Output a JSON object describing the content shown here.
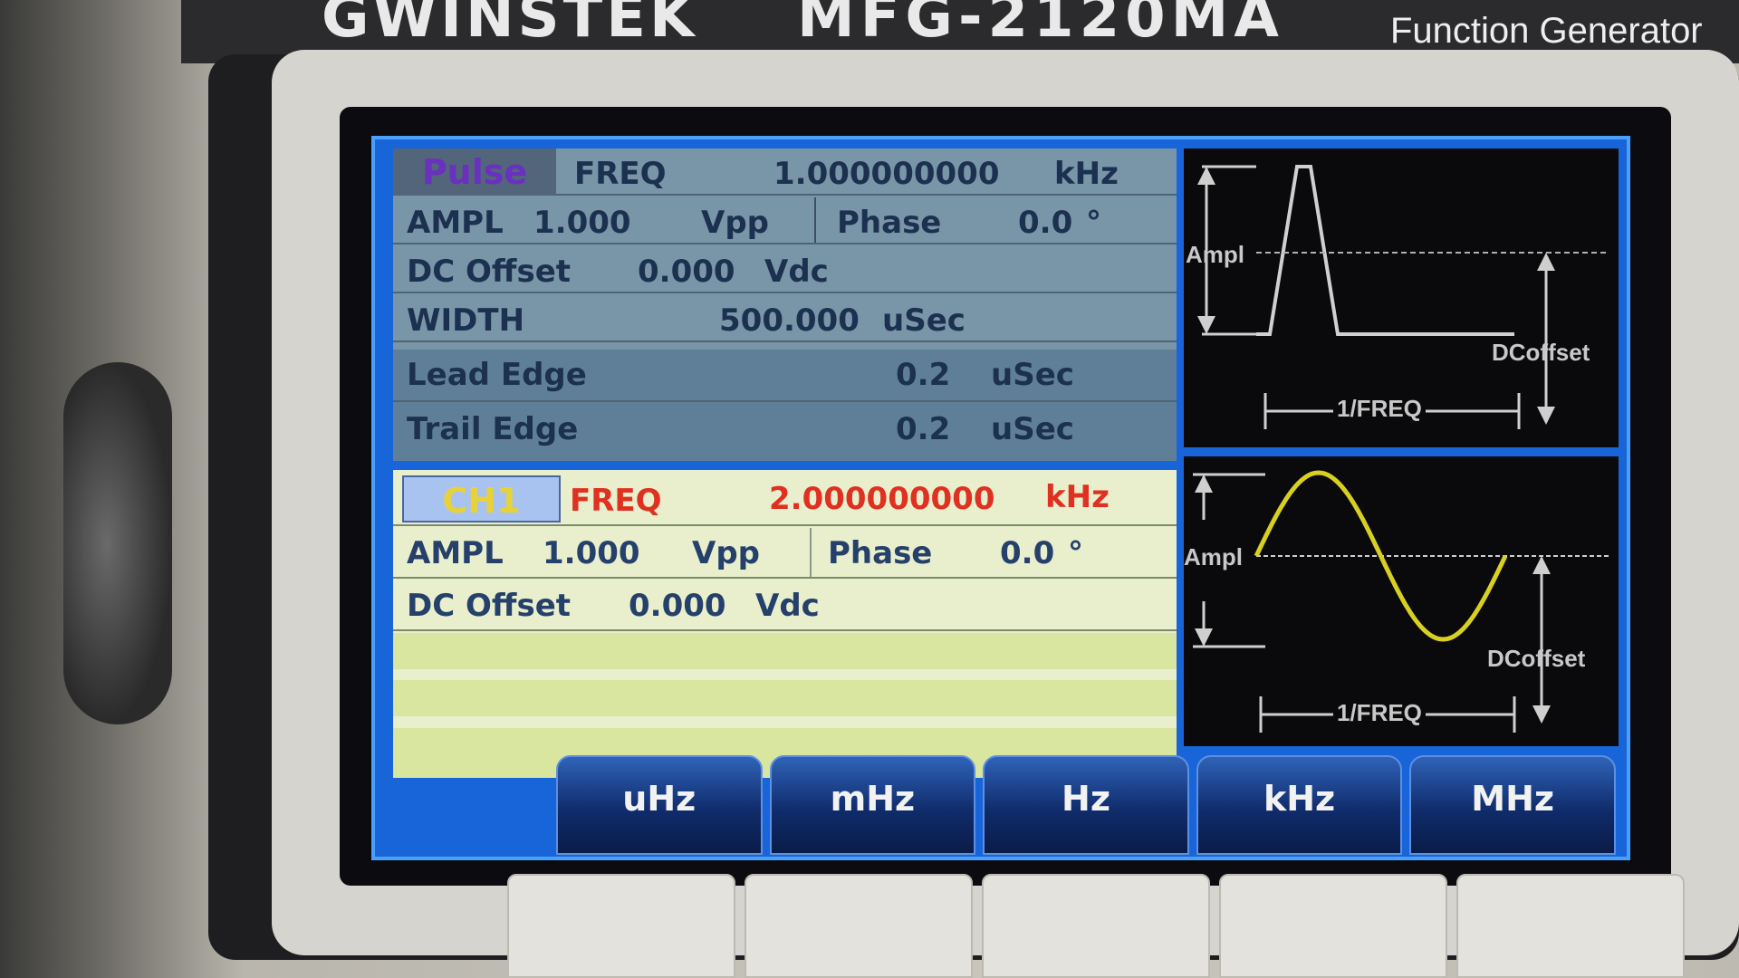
{
  "device": {
    "brand": "GWINSTEK",
    "model": "MFG-2120MA",
    "subtitle": "Function Generator"
  },
  "pulse_panel": {
    "tab_label": "Pulse",
    "freq_label": "FREQ",
    "freq_value": "1.000000000",
    "freq_unit": "kHz",
    "ampl_label": "AMPL",
    "ampl_value": "1.000",
    "ampl_unit": "Vpp",
    "phase_label": "Phase",
    "phase_value": "0.0",
    "phase_unit": "°",
    "dc_label": "DC Offset",
    "dc_value": "0.000",
    "dc_unit": "Vdc",
    "width_label": "WIDTH",
    "width_value": "500.000",
    "width_unit": "uSec",
    "lead_label": "Lead Edge",
    "lead_value": "0.2",
    "lead_unit": "uSec",
    "trail_label": "Trail Edge",
    "trail_value": "0.2",
    "trail_unit": "uSec"
  },
  "ch1_panel": {
    "tab_label": "CH1",
    "freq_label": "FREQ",
    "freq_value": "2.000000000",
    "freq_unit": "kHz",
    "ampl_label": "AMPL",
    "ampl_value": "1.000",
    "ampl_unit": "Vpp",
    "phase_label": "Phase",
    "phase_value": "0.0",
    "phase_unit": "°",
    "dc_label": "DC Offset",
    "dc_value": "0.000",
    "dc_unit": "Vdc"
  },
  "pulse_diagram": {
    "ampl_label": "Ampl",
    "offset_label": "DCoffset",
    "period_label": "1/FREQ"
  },
  "sine_diagram": {
    "ampl_label": "Ampl",
    "offset_label": "DCoffset",
    "period_label": "1/FREQ",
    "wave_color": "#d8d020"
  },
  "softkeys": [
    "uHz",
    "mHz",
    "Hz",
    "kHz",
    "MHz"
  ],
  "colors": {
    "screen_bg": "#1765d8",
    "top_panel": "#7995a8",
    "bottom_panel": "#e9efcd",
    "highlight_red": "#e03020"
  }
}
